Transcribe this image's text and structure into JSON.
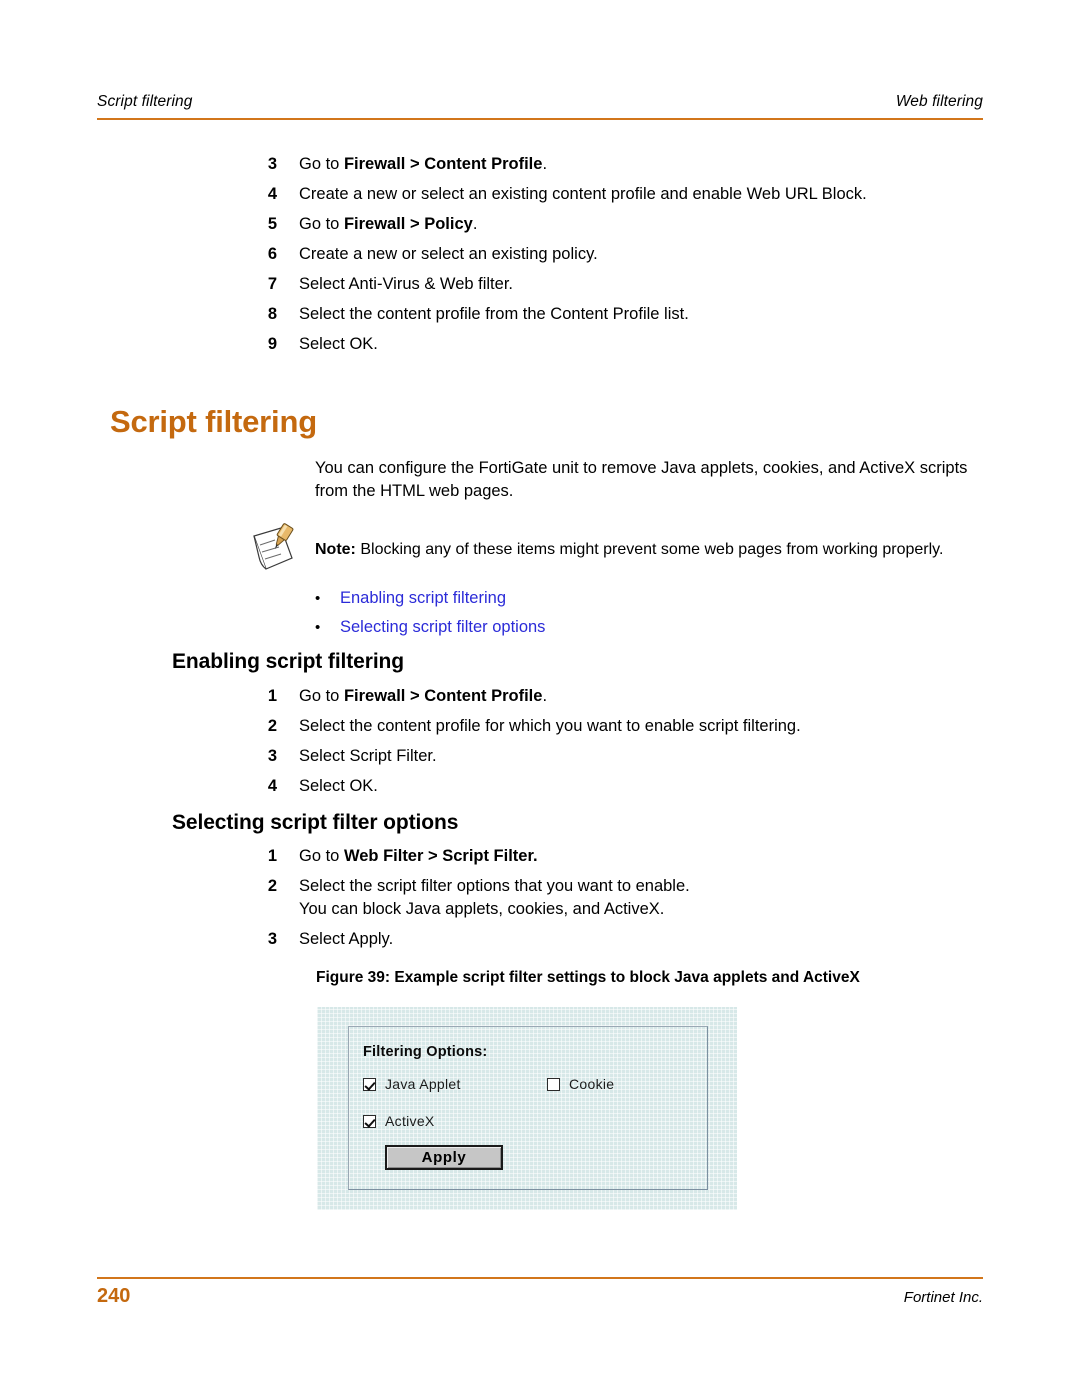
{
  "header": {
    "left": "Script filtering",
    "right": "Web filtering",
    "rule_color": "#D2761B"
  },
  "top_steps": [
    {
      "num": "3",
      "pre": "Go to ",
      "bold": "Firewall > Content Profile",
      "post": "."
    },
    {
      "num": "4",
      "pre": "Create a new or select an existing content profile and enable Web URL Block.",
      "bold": "",
      "post": ""
    },
    {
      "num": "5",
      "pre": "Go to ",
      "bold": "Firewall > Policy",
      "post": "."
    },
    {
      "num": "6",
      "pre": "Create a new or select an existing policy.",
      "bold": "",
      "post": ""
    },
    {
      "num": "7",
      "pre": "Select Anti-Virus & Web filter.",
      "bold": "",
      "post": ""
    },
    {
      "num": "8",
      "pre": "Select the content profile from the Content Profile list.",
      "bold": "",
      "post": ""
    },
    {
      "num": "9",
      "pre": "Select OK.",
      "bold": "",
      "post": ""
    }
  ],
  "main_heading": {
    "text": "Script filtering",
    "color": "#C4690F"
  },
  "intro_paragraph": "You can configure the FortiGate unit to remove Java applets, cookies, and ActiveX scripts from the HTML web pages.",
  "note": {
    "icon": "note-pencil-paper-icon",
    "label": "Note:",
    "text": " Blocking any of these items might prevent some web pages from working properly."
  },
  "bullets": {
    "link_color": "#2B2BD8",
    "items": [
      {
        "marker": "•",
        "label": "Enabling script filtering"
      },
      {
        "marker": "•",
        "label": "Selecting script filter options"
      }
    ]
  },
  "section_a": {
    "heading": "Enabling script filtering",
    "steps": [
      {
        "num": "1",
        "pre": "Go to ",
        "bold": "Firewall > Content Profile",
        "post": "."
      },
      {
        "num": "2",
        "pre": "Select the content profile for which you want to enable script filtering.",
        "bold": "",
        "post": ""
      },
      {
        "num": "3",
        "pre": "Select Script Filter.",
        "bold": "",
        "post": ""
      },
      {
        "num": "4",
        "pre": "Select OK.",
        "bold": "",
        "post": ""
      }
    ]
  },
  "section_b": {
    "heading": "Selecting script filter options",
    "steps": [
      {
        "num": "1",
        "pre": "Go to ",
        "bold": "Web Filter > Script Filter.",
        "post": ""
      },
      {
        "num": "2",
        "pre": "Select the script filter options that you want to enable.",
        "bold": "",
        "post": "",
        "line2": "You can block Java applets, cookies, and ActiveX."
      },
      {
        "num": "3",
        "pre": "Select Apply.",
        "bold": "",
        "post": ""
      }
    ]
  },
  "figure": {
    "caption": "Figure 39: Example script filter settings to block Java applets and ActiveX",
    "background_color": "#d7e8e8",
    "panel_title": "Filtering Options:",
    "checkboxes": [
      {
        "label": "Java Applet",
        "checked": true
      },
      {
        "label": "Cookie",
        "checked": false
      },
      {
        "label": "ActiveX",
        "checked": true
      }
    ],
    "apply_button": "Apply"
  },
  "footer": {
    "page_number": "240",
    "publisher": "Fortinet Inc.",
    "rule_color": "#D2761B"
  }
}
